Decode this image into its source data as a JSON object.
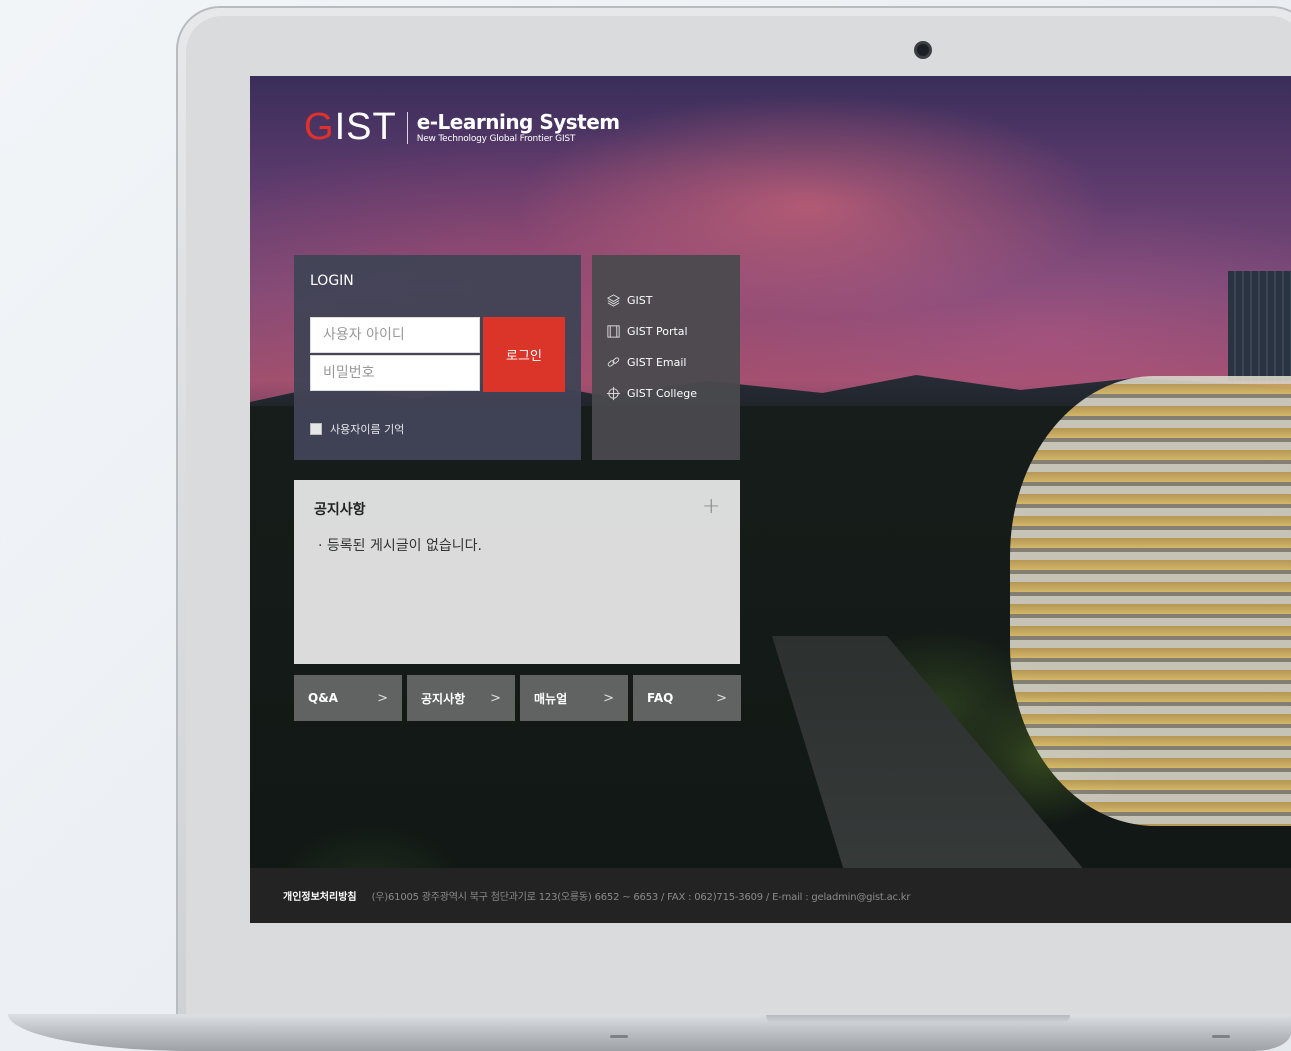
{
  "logo": {
    "mark_first": "G",
    "mark_rest": "IST",
    "title": "e-Learning System",
    "subtitle": "New Technology Global Frontier GIST"
  },
  "login": {
    "title": "LOGIN",
    "username_placeholder": "사용자 아이디",
    "password_placeholder": "비밀번호",
    "button_label": "로그인",
    "remember_label": "사용자이름 기억"
  },
  "links": [
    {
      "label": "GIST",
      "icon": "layers-icon"
    },
    {
      "label": "GIST Portal",
      "icon": "portal-icon"
    },
    {
      "label": "GIST Email",
      "icon": "link-icon"
    },
    {
      "label": "GIST College",
      "icon": "crosshair-icon"
    }
  ],
  "notice": {
    "title": "공지사항",
    "more_symbol": "+",
    "empty_message": "· 등록된 게시글이 없습니다."
  },
  "quick_links": [
    {
      "label": "Q&A",
      "arrow": ">"
    },
    {
      "label": "공지사항",
      "arrow": ">"
    },
    {
      "label": "매뉴얼",
      "arrow": ">"
    },
    {
      "label": "FAQ",
      "arrow": ">"
    }
  ],
  "footer": {
    "policy": "개인정보처리방침",
    "address": "(우)61005 광주광역시 북구 첨단과기로 123(오룡동) 6652 ~ 6653 / FAX : 062)715-3609 / E-mail : geladmin@gist.ac.kr"
  },
  "colors": {
    "accent": "#da3528",
    "login_panel": "#424456",
    "links_panel": "#4a4a4e",
    "footer": "#232324"
  }
}
